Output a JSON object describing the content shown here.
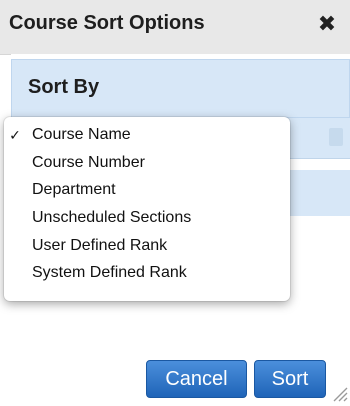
{
  "dialog": {
    "title": "Course Sort Options",
    "close_glyph": "✖"
  },
  "sort_by": {
    "label": "Sort By",
    "options": [
      {
        "label": "Course Name",
        "checked": true
      },
      {
        "label": "Course Number",
        "checked": false
      },
      {
        "label": "Department",
        "checked": false
      },
      {
        "label": "Unscheduled Sections",
        "checked": false
      },
      {
        "label": "User Defined Rank",
        "checked": false
      },
      {
        "label": "System Defined Rank",
        "checked": false
      }
    ],
    "check_glyph": "✓"
  },
  "buttons": {
    "cancel": "Cancel",
    "sort": "Sort"
  },
  "colors": {
    "accent": "#2b6fc4",
    "header_bg": "#d7e7f7",
    "titlebar_bg": "#e8e8e8"
  }
}
